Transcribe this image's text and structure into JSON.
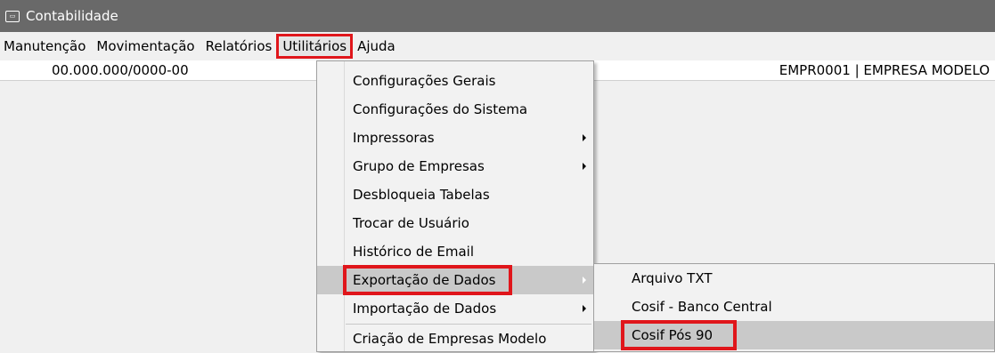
{
  "window": {
    "title": "Contabilidade",
    "icon": "window-app-icon"
  },
  "menubar": {
    "items": [
      {
        "label": "Manutenção"
      },
      {
        "label": "Movimentação"
      },
      {
        "label": "Relatórios"
      },
      {
        "label": "Utilitários",
        "active": true
      },
      {
        "label": "Ajuda"
      }
    ]
  },
  "infobar": {
    "cnpj": "00.000.000/0000-00",
    "empresa": "EMPR0001 | EMPRESA MODELO"
  },
  "utilitarios_menu": {
    "items": [
      {
        "label": "Configurações Gerais"
      },
      {
        "label": "Configurações do Sistema"
      },
      {
        "label": "Impressoras",
        "submenu": true
      },
      {
        "label": "Grupo de Empresas",
        "submenu": true
      },
      {
        "label": "Desbloqueia Tabelas"
      },
      {
        "label": "Trocar de Usuário"
      },
      {
        "label": "Histórico de Email"
      },
      {
        "label": "Exportação de Dados",
        "submenu": true,
        "hover": true
      },
      {
        "label": "Importação de Dados",
        "submenu": true
      },
      {
        "label": "Criação de Empresas Modelo"
      }
    ]
  },
  "exportacao_submenu": {
    "items": [
      {
        "label": "Arquivo TXT"
      },
      {
        "label": "Cosif - Banco Central"
      },
      {
        "label": "Cosif Pós 90",
        "selected": true
      }
    ]
  },
  "colors": {
    "titlebar": "#696969",
    "highlight": "#e0161b",
    "hover": "#c9c9c9"
  }
}
